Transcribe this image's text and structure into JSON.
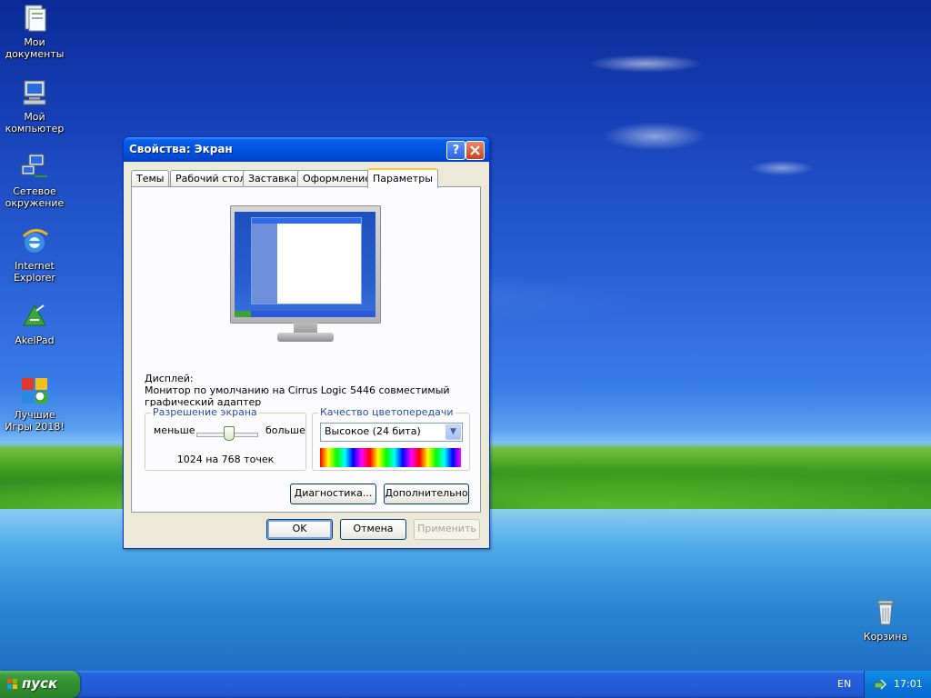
{
  "desktop": {
    "icons": [
      {
        "label": "Мои документы",
        "icon": "my-documents-icon"
      },
      {
        "label": "Мой компьютер",
        "icon": "my-computer-icon"
      },
      {
        "label": "Сетевое окружение",
        "icon": "network-places-icon"
      },
      {
        "label": "Internet Explorer",
        "icon": "internet-explorer-icon"
      },
      {
        "label": "AkelPad",
        "icon": "akelpad-icon"
      },
      {
        "label": "Лучшие Игры 2018!",
        "icon": "games-icon"
      },
      {
        "label": "Корзина",
        "icon": "recycle-bin-icon"
      }
    ]
  },
  "dialog": {
    "title": "Свойства: Экран",
    "help_button": "?",
    "tabs": [
      {
        "label": "Темы"
      },
      {
        "label": "Рабочий стол"
      },
      {
        "label": "Заставка"
      },
      {
        "label": "Оформление"
      },
      {
        "label": "Параметры",
        "active": true
      }
    ],
    "display_label": "Дисплей:",
    "display_name": "Монитор по умолчанию на Cirrus Logic 5446 совместимый графический адаптер",
    "resolution": {
      "legend": "Разрешение экрана",
      "less": "меньше",
      "more": "больше",
      "value": "1024 на 768 точек",
      "slider_level": 0.5
    },
    "color_quality": {
      "legend": "Качество цветопередачи",
      "selected": "Высокое (24 бита)"
    },
    "buttons": {
      "diagnostics": "Диагностика...",
      "advanced": "Дополнительно",
      "ok": "OK",
      "cancel": "Отмена",
      "apply": "Применить"
    }
  },
  "taskbar": {
    "start_label": "пуск",
    "language": "EN",
    "clock": "17:01"
  },
  "colors": {
    "title_bar": "#0054e3",
    "start_button": "#3c9e3c",
    "taskbar": "#245edb",
    "dialog_bg": "#ece9d8",
    "active_tab_accent": "#ffc83c"
  }
}
